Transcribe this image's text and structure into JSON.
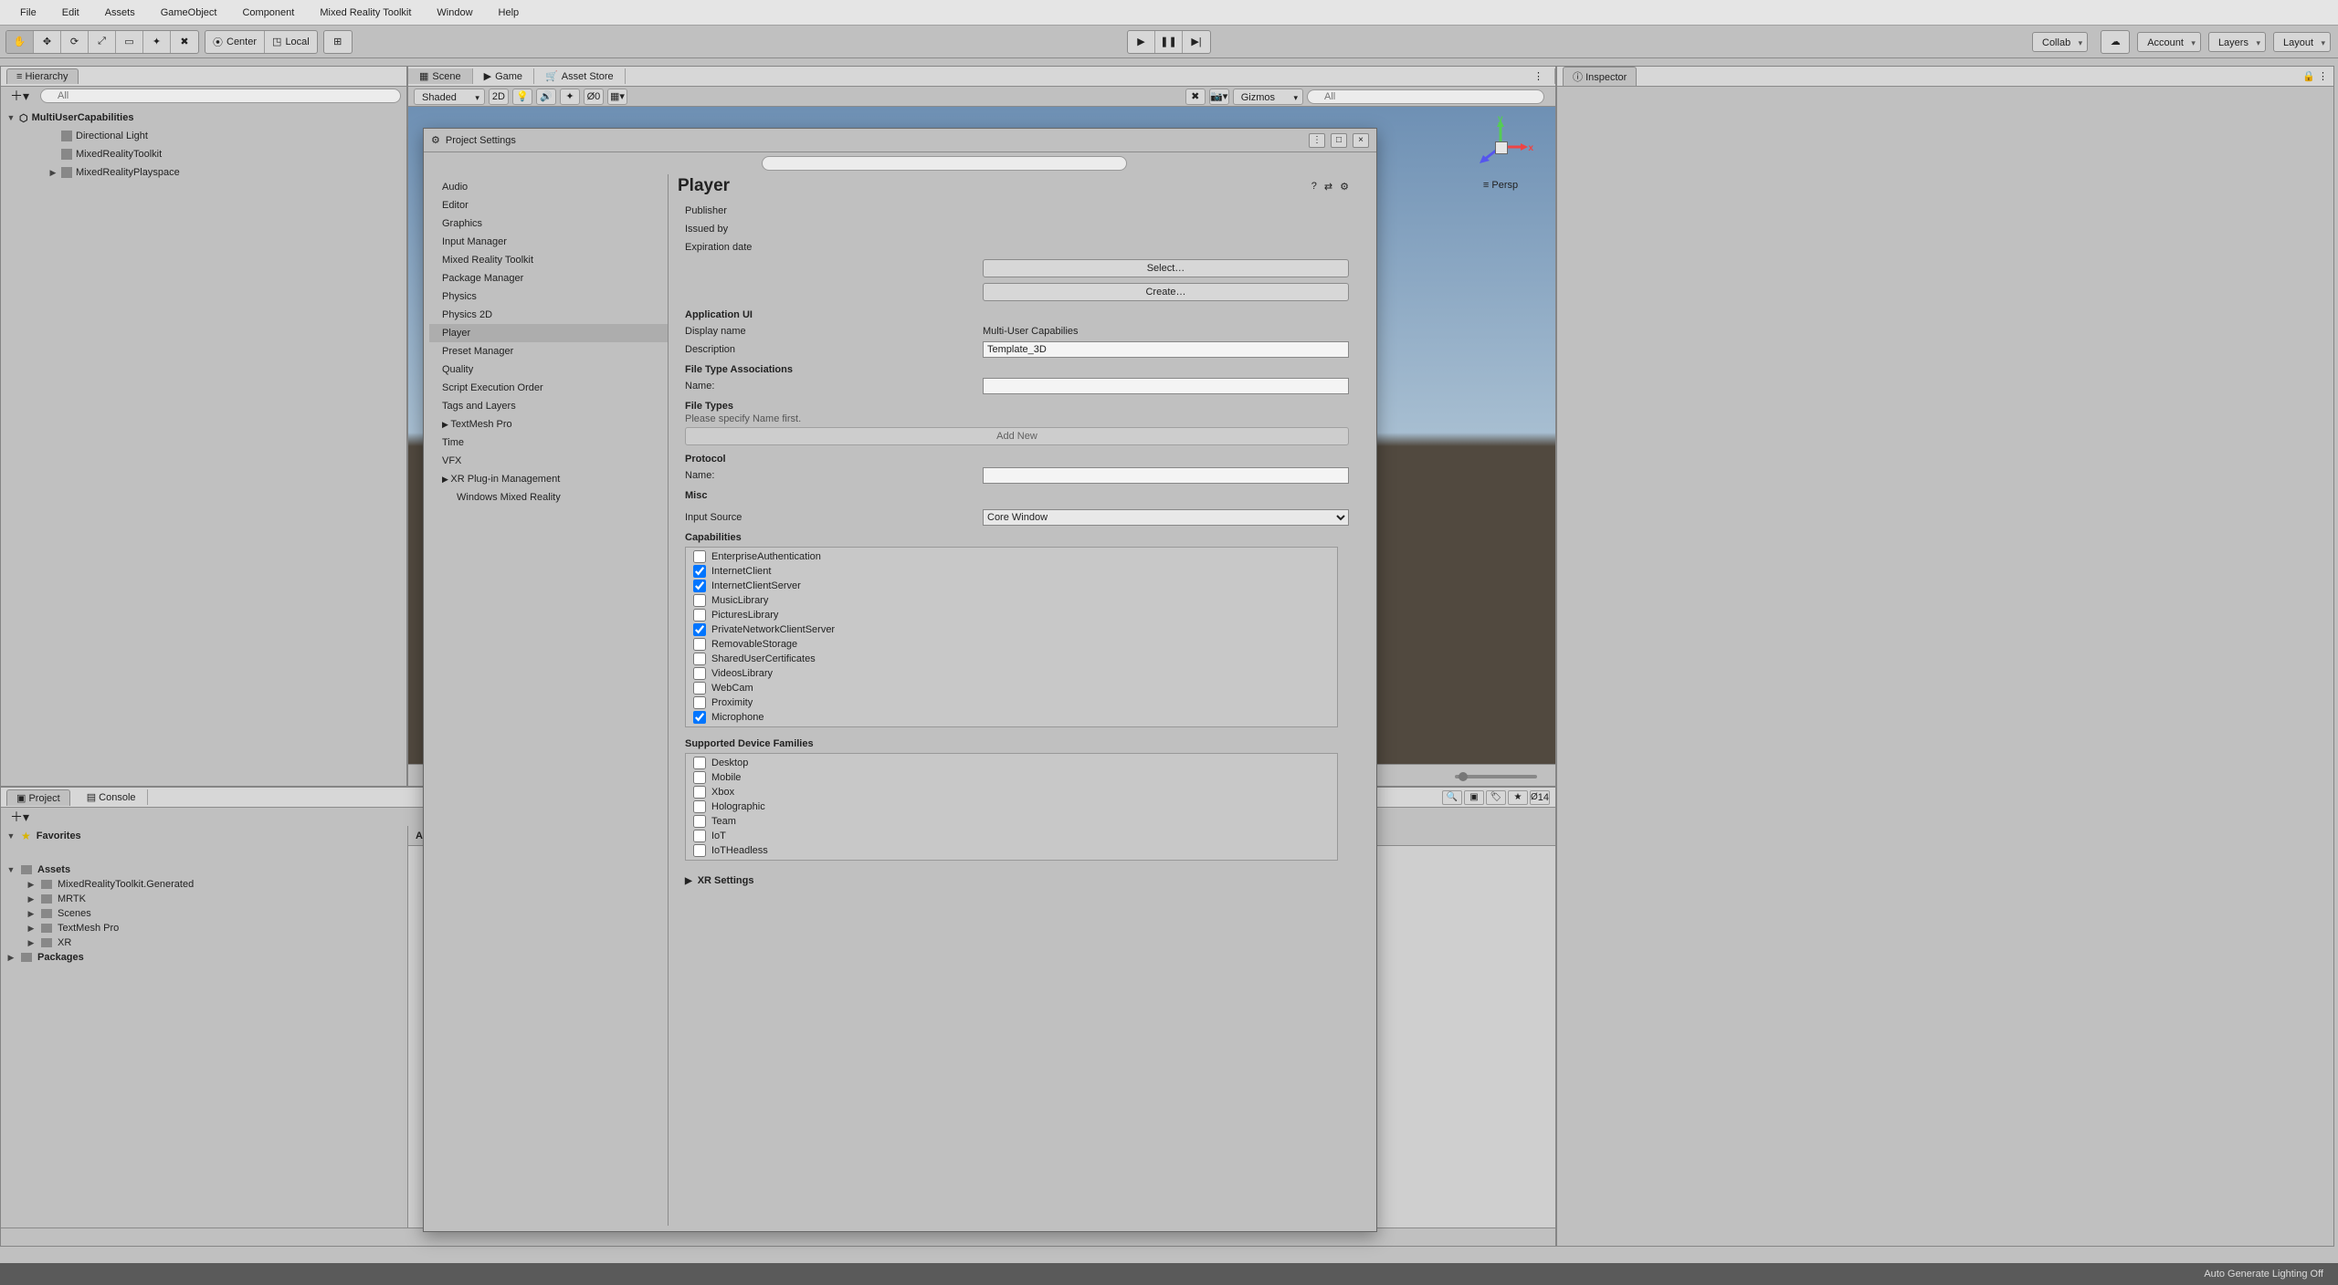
{
  "menubar": [
    "File",
    "Edit",
    "Assets",
    "GameObject",
    "Component",
    "Mixed Reality Toolkit",
    "Window",
    "Help"
  ],
  "toolbar": {
    "pivot_center": "Center",
    "pivot_local": "Local",
    "right": {
      "collab": "Collab",
      "account": "Account",
      "layers": "Layers",
      "layout": "Layout"
    }
  },
  "hierarchy": {
    "title": "Hierarchy",
    "search_placeholder": "All",
    "root": "MultiUserCapabilities",
    "children": [
      "Directional Light",
      "MixedRealityToolkit",
      "MixedRealityPlayspace"
    ]
  },
  "scene": {
    "tabs": [
      "Scene",
      "Game",
      "Asset Store"
    ],
    "shaded": "Shaded",
    "btn_2d": "2D",
    "gizmos": "Gizmos",
    "search_placeholder": "All",
    "persp": "Persp",
    "skybox_toggle_count": "0"
  },
  "inspector": {
    "title": "Inspector"
  },
  "project": {
    "tabs": [
      "Project",
      "Console"
    ],
    "favorites": "Favorites",
    "assets": "Assets",
    "assets_children": [
      "MixedRealityToolkit.Generated",
      "MRTK",
      "Scenes",
      "TextMesh Pro",
      "XR"
    ],
    "packages": "Packages",
    "right_header": "A",
    "hidden_count_label": "14"
  },
  "psettings": {
    "title": "Project Settings",
    "nav": [
      "Audio",
      "Editor",
      "Graphics",
      "Input Manager",
      "Mixed Reality Toolkit",
      "Package Manager",
      "Physics",
      "Physics 2D",
      "Player",
      "Preset Manager",
      "Quality",
      "Script Execution Order",
      "Tags and Layers",
      "TextMesh Pro",
      "Time",
      "VFX",
      "XR Plug-in Management"
    ],
    "nav_sub": "Windows Mixed Reality",
    "selected": "Player",
    "player": {
      "title": "Player",
      "publisher": "Publisher",
      "issued": "Issued by",
      "expiration": "Expiration date",
      "btn_select": "Select…",
      "btn_create": "Create…",
      "sec_appui": "Application UI",
      "displayname_label": "Display name",
      "displayname_value": "Multi-User Capabilies",
      "description_label": "Description",
      "description_value": "Template_3D",
      "sec_fta": "File Type Associations",
      "name_label": "Name:",
      "sec_ft": "File Types",
      "ft_note": "Please specify Name first.",
      "btn_addnew": "Add New",
      "sec_protocol": "Protocol",
      "sec_misc": "Misc",
      "input_source_label": "Input Source",
      "input_source_value": "Core Window",
      "sec_capabilities": "Capabilities",
      "caps": [
        {
          "label": "EnterpriseAuthentication",
          "checked": false
        },
        {
          "label": "InternetClient",
          "checked": true
        },
        {
          "label": "InternetClientServer",
          "checked": true
        },
        {
          "label": "MusicLibrary",
          "checked": false
        },
        {
          "label": "PicturesLibrary",
          "checked": false
        },
        {
          "label": "PrivateNetworkClientServer",
          "checked": true
        },
        {
          "label": "RemovableStorage",
          "checked": false
        },
        {
          "label": "SharedUserCertificates",
          "checked": false
        },
        {
          "label": "VideosLibrary",
          "checked": false
        },
        {
          "label": "WebCam",
          "checked": false
        },
        {
          "label": "Proximity",
          "checked": false
        },
        {
          "label": "Microphone",
          "checked": true
        }
      ],
      "sec_sdf": "Supported Device Families",
      "devfams": [
        "Desktop",
        "Mobile",
        "Xbox",
        "Holographic",
        "Team",
        "IoT",
        "IoTHeadless"
      ],
      "xr_settings": "XR Settings"
    }
  },
  "status": {
    "auto_light": "Auto Generate Lighting Off"
  }
}
